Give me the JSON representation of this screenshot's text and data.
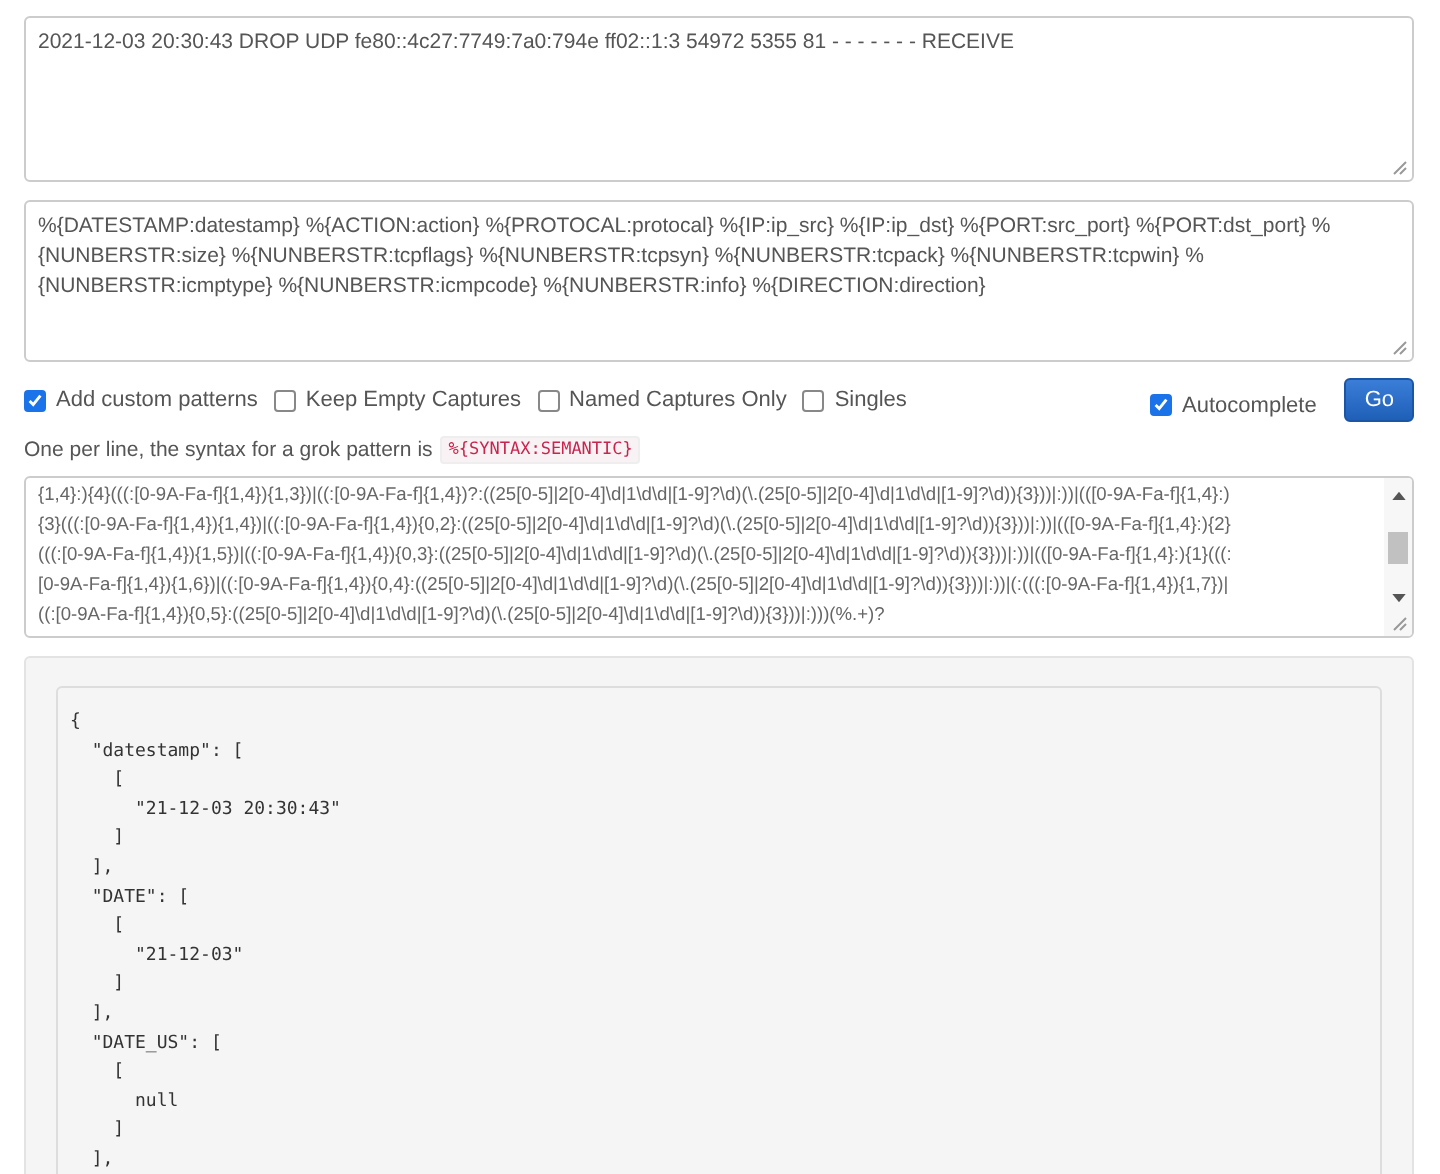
{
  "log_input": {
    "value": "2021-12-03 20:30:43 DROP UDP fe80::4c27:7749:7a0:794e ff02::1:3 54972 5355 81 - - - - - - - RECEIVE"
  },
  "pattern_input": {
    "value": "%{DATESTAMP:datestamp} %{ACTION:action} %{PROTOCAL:protocal} %{IP:ip_src} %{IP:ip_dst} %{PORT:src_port} %{PORT:dst_port} %{NUNBERSTR:size} %{NUNBERSTR:tcpflags} %{NUNBERSTR:tcpsyn} %{NUNBERSTR:tcpack} %{NUNBERSTR:tcpwin} %{NUNBERSTR:icmptype} %{NUNBERSTR:icmpcode} %{NUNBERSTR:info} %{DIRECTION:direction}"
  },
  "options": [
    {
      "label": "Add custom patterns",
      "checked": true
    },
    {
      "label": "Keep Empty Captures",
      "checked": false
    },
    {
      "label": "Named Captures Only",
      "checked": false
    },
    {
      "label": "Singles",
      "checked": false
    }
  ],
  "autocomplete": {
    "label": "Autocomplete",
    "checked": true
  },
  "go_button": "Go",
  "hint": {
    "text": "One per line, the syntax for a grok pattern is",
    "code": "%{SYNTAX:SEMANTIC}"
  },
  "custom_patterns": [
    "{1,4}:){4}(((:[0-9A-Fa-f]{1,4}){1,3})|((:[0-9A-Fa-f]{1,4})?:((25[0-5]|2[0-4]\\d|1\\d\\d|[1-9]?\\d)(\\.(25[0-5]|2[0-4]\\d|1\\d\\d|[1-9]?\\d)){3}))|:))|(([0-9A-Fa-f]{1,4}:)",
    "{3}(((:[0-9A-Fa-f]{1,4}){1,4})|((:[0-9A-Fa-f]{1,4}){0,2}:((25[0-5]|2[0-4]\\d|1\\d\\d|[1-9]?\\d)(\\.(25[0-5]|2[0-4]\\d|1\\d\\d|[1-9]?\\d)){3}))|:))|(([0-9A-Fa-f]{1,4}:){2}",
    "(((:[0-9A-Fa-f]{1,4}){1,5})|((:[0-9A-Fa-f]{1,4}){0,3}:((25[0-5]|2[0-4]\\d|1\\d\\d|[1-9]?\\d)(\\.(25[0-5]|2[0-4]\\d|1\\d\\d|[1-9]?\\d)){3}))|:))|(([0-9A-Fa-f]{1,4}:){1}(((:",
    "[0-9A-Fa-f]{1,4}){1,6})|((:[0-9A-Fa-f]{1,4}){0,4}:((25[0-5]|2[0-4]\\d|1\\d\\d|[1-9]?\\d)(\\.(25[0-5]|2[0-4]\\d|1\\d\\d|[1-9]?\\d)){3}))|:))|(:(((:[0-9A-Fa-f]{1,4}){1,7})|",
    "((:[0-9A-Fa-f]{1,4}){0,5}:((25[0-5]|2[0-4]\\d|1\\d\\d|[1-9]?\\d)(\\.(25[0-5]|2[0-4]\\d|1\\d\\d|[1-9]?\\d)){3}))|:)))(%.+)?"
  ],
  "output": [
    "{",
    "  \"datestamp\": [",
    "    [",
    "      \"21-12-03 20:30:43\"",
    "    ]",
    "  ],",
    "  \"DATE\": [",
    "    [",
    "      \"21-12-03\"",
    "    ]",
    "  ],",
    "  \"DATE_US\": [",
    "    [",
    "      null",
    "    ]",
    "  ],"
  ]
}
